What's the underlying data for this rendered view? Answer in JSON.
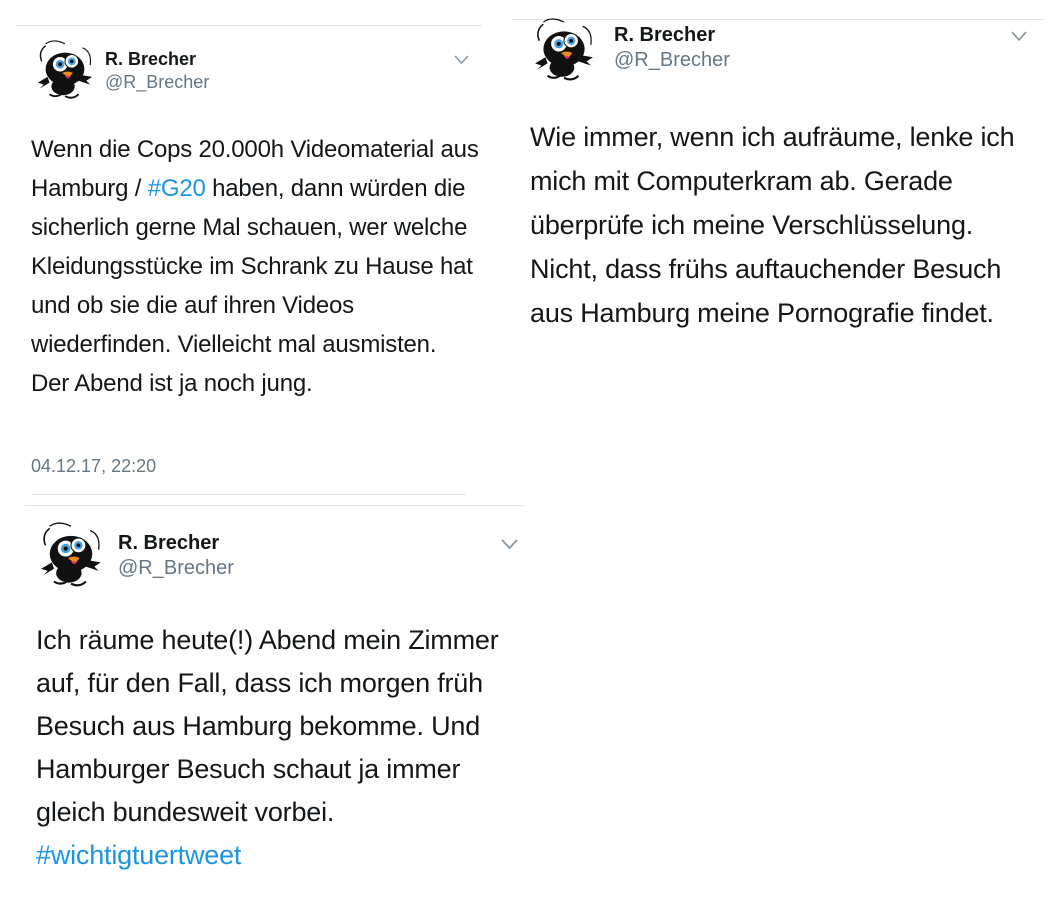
{
  "tweets": [
    {
      "author_name": "R. Brecher",
      "author_handle": "@R_Brecher",
      "text_before": "Wenn die Cops 20.000h Videomaterial aus Hamburg / ",
      "hashtag": "#G20",
      "text_after": " haben, dann würden die sicherlich gerne Mal schauen, wer welche Kleidungsstücke im Schrank zu Hause hat und ob sie die auf ihren Videos wiederfinden. Vielleicht mal ausmisten. Der Abend ist ja noch jung.",
      "timestamp": "04.12.17, 22:20"
    },
    {
      "author_name": "R. Brecher",
      "author_handle": "@R_Brecher",
      "text": "Wie immer, wenn ich aufräume, lenke ich mich mit Computerkram ab. Gerade überprüfe ich meine Verschlüsselung. Nicht, dass frühs auftauchender Besuch aus Hamburg meine Pornografie findet."
    },
    {
      "author_name": "R. Brecher",
      "author_handle": "@R_Brecher",
      "text": "Ich räume heute(!) Abend mein Zimmer auf, für den Fall, dass ich morgen früh Besuch aus Hamburg bekomme. Und Hamburger Besuch schaut ja immer gleich bundesweit vorbei.",
      "hashtag": "#wichtigtuertweet"
    }
  ],
  "icons": {
    "avatar": "black-cat-cartoon-avatar",
    "menu": "chevron-down-icon"
  },
  "colors": {
    "hashtag": "#1b95e0",
    "secondary": "#657786",
    "divider": "#e1e8ed"
  }
}
